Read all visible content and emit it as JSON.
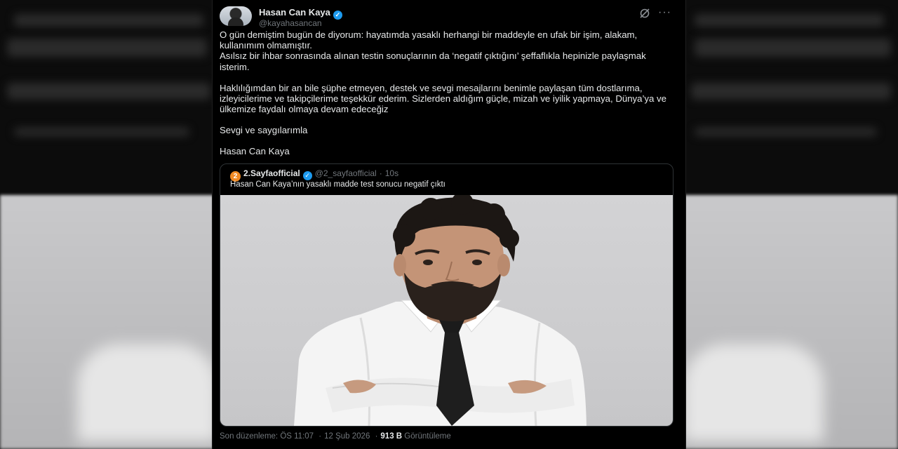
{
  "tweet": {
    "author_name": "Hasan Can Kaya",
    "author_handle": "@kayahasancan",
    "paragraphs": [
      "O gün demiştim bugün de diyorum: hayatımda  yasaklı herhangi bir maddeyle en ufak bir işim, alakam, kullanımım olmamıştır.\nAsılsız bir ihbar sonrasında alınan testin sonuçlarının da ‘negatif çıktığını’ şeffaflıkla hepinizle paylaşmak isterim.",
      "Haklılığımdan bir an bile şüphe etmeyen, destek ve sevgi mesajlarını benimle paylaşan tüm dostlarıma, izleyicilerime ve takipçilerime teşekkür ederim. Sizlerden aldığım güçle, mizah ve iyilik yapmaya, Dünya’ya ve ülkemize faydalı olmaya devam edeceğiz",
      "Sevgi ve saygılarımla",
      "Hasan Can Kaya"
    ],
    "icons": {
      "verified": "verified-badge-icon",
      "grok": "grok-icon",
      "more": "more-options-icon"
    },
    "accent_color": "#1d9bf0"
  },
  "quote": {
    "avatar_text": "2",
    "author_name": "2.Sayfaofficial",
    "author_handle": "@2_sayfaofficial",
    "separator": "·",
    "time": "10s",
    "text": "Hasan Can Kaya’nın yasaklı madde test sonucu negatif çıktı",
    "image": "portrait-photo"
  },
  "footer": {
    "edited_label": "Son düzenleme:",
    "time": "ÖS 11:07",
    "dot": "·",
    "date": "12 Şub 2026",
    "views_count": "913 B",
    "views_label": "Görüntüleme"
  }
}
